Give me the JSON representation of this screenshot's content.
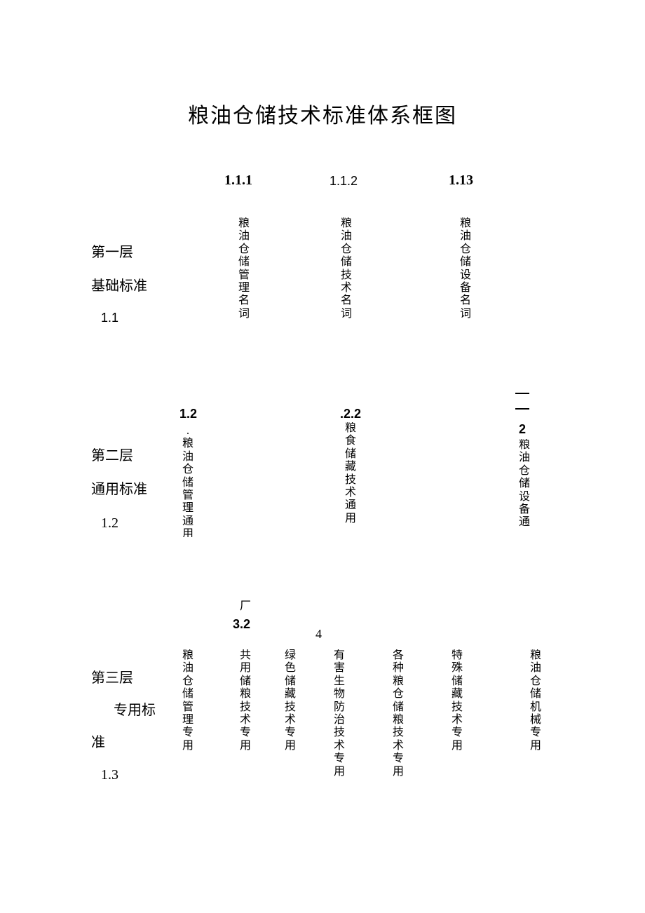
{
  "title": "粮油仓储技术标准体系框图",
  "layer1": {
    "label1": "第一层",
    "label2": "基础标准",
    "label3": "1.1",
    "cols": [
      {
        "num": "1.1.1",
        "text": "粮油仓储管理名词"
      },
      {
        "num": "1.1.2",
        "text": "粮油仓储技术名词"
      },
      {
        "num": "1.13",
        "text": "粮油仓储设备名词"
      }
    ]
  },
  "layer2": {
    "label1": "第二层",
    "label2": "通用标准",
    "label3": "1.2",
    "cols": [
      {
        "num": "1.2",
        "text": ".粮油仓储管理通用"
      },
      {
        "num": ".2.2",
        "text": "粮食储藏技术通用"
      },
      {
        "num": "2",
        "text": "粮油仓储设备通"
      }
    ]
  },
  "layer3": {
    "label1": "第三层",
    "label2": "专用标",
    "label2b": "准",
    "label3": "1.3",
    "fragTop": "厂",
    "num32": "3.2",
    "frag4": "4",
    "cols": [
      {
        "text": "粮油仓储管理专用"
      },
      {
        "text": "共用储粮技术专用"
      },
      {
        "text": "绿色储藏技术专用"
      },
      {
        "text": "有害生物防治技术专用"
      },
      {
        "text": "各种粮仓储粮技术专用"
      },
      {
        "text": "特殊储藏技术专用"
      },
      {
        "text": "粮油仓储机械专用"
      }
    ]
  }
}
